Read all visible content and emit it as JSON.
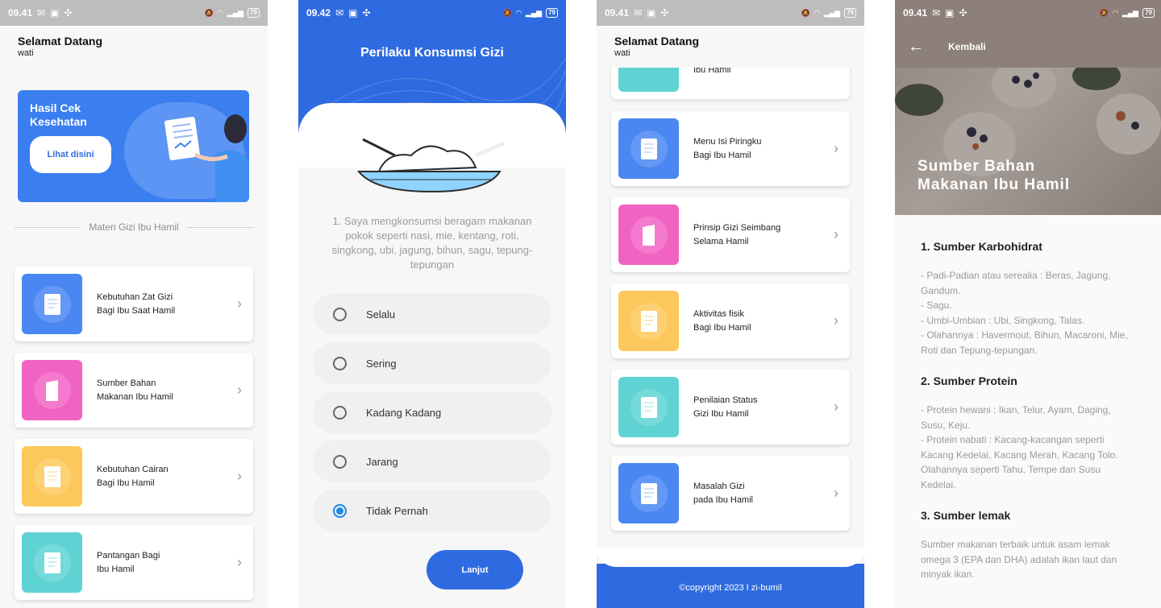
{
  "status": {
    "p1_time": "09.41",
    "p2_time": "09.42",
    "p3_time": "09.41",
    "p4_time": "09.41",
    "battery": "79"
  },
  "home": {
    "greeting": "Selamat Datang",
    "username": "wati",
    "health_title": "Hasil Cek Kesehatan",
    "health_button": "Lihat disini",
    "section_title": "Materi Gizi Ibu Hamil",
    "cards": [
      {
        "line1": "Kebutuhan Zat Gizi",
        "line2": "Bagi Ibu Saat Hamil"
      },
      {
        "line1": "Sumber Bahan",
        "line2": "Makanan Ibu Hamil"
      },
      {
        "line1": "Kebutuhan Cairan",
        "line2": "Bagi Ibu Hamil"
      },
      {
        "line1": "Pantangan Bagi",
        "line2": "Ibu Hamil"
      }
    ]
  },
  "quiz": {
    "title": "Perilaku Konsumsi Gizi",
    "question": "1. Saya mengkonsumsi beragam makanan pokok seperti nasi, mie, kentang, roti, singkong, ubi, jagung, bihun, sagu, tepung-tepungan",
    "options": [
      "Selalu",
      "Sering",
      "Kadang Kadang",
      "Jarang",
      "Tidak Pernah"
    ],
    "selected_index": 4,
    "next_button": "Lanjut"
  },
  "list": {
    "greeting": "Selamat Datang",
    "username": "wati",
    "partial_label": "Ibu Hamil",
    "cards": [
      {
        "line1": "Menu Isi Piringku",
        "line2": "Bagi Ibu Hamil"
      },
      {
        "line1": "Prinsip Gizi Seimbang",
        "line2": "Selama Hamil"
      },
      {
        "line1": "Aktivitas fisik",
        "line2": "Bagi Ibu Hamil"
      },
      {
        "line1": "Penilaian Status",
        "line2": "Gizi Ibu Hamil"
      },
      {
        "line1": "Masalah Gizi",
        "line2": "pada Ibu Hamil"
      }
    ],
    "copyright": "©copyright 2023 I zi-bumil"
  },
  "detail": {
    "back_label": "Kembali",
    "hero_title_1": "Sumber Bahan",
    "hero_title_2": "Makanan Ibu Hamil",
    "sections": [
      {
        "heading": "1. Sumber Karbohidrat",
        "body": "- Padi-Padian atau serealia : Beras, Jagung, Gandum.\n- Sagu.\n- Umbi-Umbian : Ubi, Singkong, Talas.\n- Olahannya : Havermout, Bihun, Macaroni, Mie, Roti dan Tepung-tepungan."
      },
      {
        "heading": "2. Sumber Protein",
        "body": "- Protein hewani : Ikan, Telur, Ayam, Daging, Susu, Keju.\n- Protein nabati : Kacang-kacangan seperti Kacang Kedelai, Kacang Merah, Kacang Tolo. Olahannya seperti Tahu, Tempe dan Susu Kedelai."
      },
      {
        "heading": "3. Sumber lemak",
        "body": "Sumber makanan terbaik untuk asam lemak omega 3 (EPA dan DHA) adalah ikan laut dan minyak ikan."
      }
    ]
  },
  "colors": {
    "primary": "#2f6be0",
    "blue_thumb": "#4a87f2",
    "pink_thumb": "#f163c3",
    "yellow_thumb": "#fdc85b",
    "teal_thumb": "#5fd3d4"
  }
}
